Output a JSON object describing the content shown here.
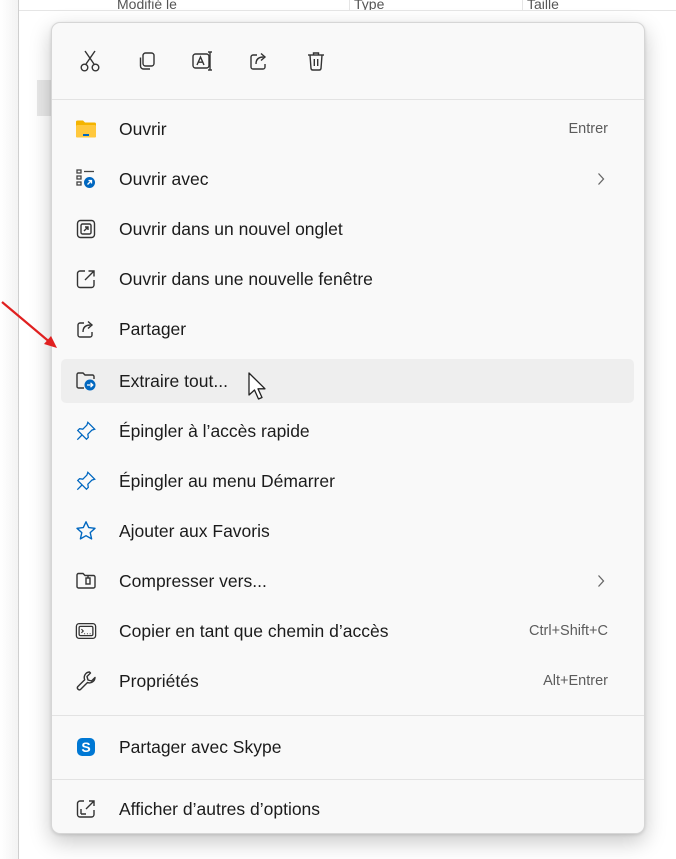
{
  "background": {
    "columns": [
      "Modifié le",
      "Type",
      "Taille"
    ]
  },
  "toolbar": {
    "icons": [
      "cut-icon",
      "copy-icon",
      "rename-icon",
      "share-icon",
      "delete-icon"
    ]
  },
  "menu": {
    "items": [
      {
        "label": "Ouvrir",
        "shortcut": "Entrer",
        "icon": "folder-icon"
      },
      {
        "label": "Ouvrir avec",
        "shortcut": "",
        "icon": "open-with-icon",
        "submenu": true
      },
      {
        "label": "Ouvrir dans un nouvel onglet",
        "shortcut": "",
        "icon": "new-tab-icon"
      },
      {
        "label": "Ouvrir dans une nouvelle fenêtre",
        "shortcut": "",
        "icon": "new-window-icon"
      },
      {
        "label": "Partager",
        "shortcut": "",
        "icon": "share-icon"
      },
      {
        "label": "Extraire tout...",
        "shortcut": "",
        "icon": "extract-icon",
        "highlighted": true
      },
      {
        "label": "Épingler à l’accès rapide",
        "shortcut": "",
        "icon": "pin-icon"
      },
      {
        "label": "Épingler au menu Démarrer",
        "shortcut": "",
        "icon": "pin-icon"
      },
      {
        "label": "Ajouter aux Favoris",
        "shortcut": "",
        "icon": "star-icon"
      },
      {
        "label": "Compresser vers...",
        "shortcut": "",
        "icon": "zip-icon",
        "submenu": true
      },
      {
        "label": "Copier en tant que chemin d’accès",
        "shortcut": "Ctrl+Shift+C",
        "icon": "path-icon"
      },
      {
        "label": "Propriétés",
        "shortcut": "Alt+Entrer",
        "icon": "wrench-icon"
      },
      {
        "label": "Partager avec Skype",
        "shortcut": "",
        "icon": "skype-icon"
      },
      {
        "label": "Afficher d’autres d’options",
        "shortcut": "",
        "icon": "more-options-icon"
      }
    ]
  },
  "colors": {
    "accent": "#0067c0",
    "annotation_arrow": "#e02020",
    "menu_bg": "#f9f9f9",
    "hover_bg": "#eeeeee"
  }
}
